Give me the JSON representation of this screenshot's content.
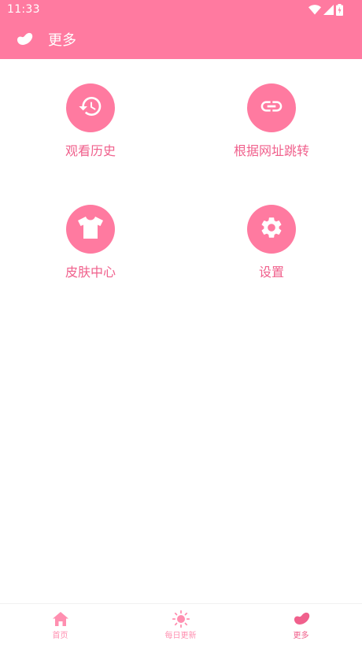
{
  "colors": {
    "primary": "#ff7aa0",
    "label": "#f0608c",
    "nav_inactive": "#ff8fb0",
    "background": "#ffffff"
  },
  "status_bar": {
    "time": "11:33",
    "icons": [
      "wifi-icon",
      "cellular-signal-icon",
      "battery-charging-icon"
    ]
  },
  "app_bar": {
    "logo_icon": "bean-logo-icon",
    "title": "更多"
  },
  "menu": [
    {
      "label": "观看历史",
      "icon": "history-icon"
    },
    {
      "label": "根据网址跳转",
      "icon": "link-icon"
    },
    {
      "label": "皮肤中心",
      "icon": "tshirt-icon"
    },
    {
      "label": "设置",
      "icon": "gear-icon"
    }
  ],
  "bottom_nav": {
    "items": [
      {
        "label": "首页",
        "icon": "home-icon",
        "active": false
      },
      {
        "label": "每日更新",
        "icon": "sun-icon",
        "active": false
      },
      {
        "label": "更多",
        "icon": "bean-icon",
        "active": true
      }
    ]
  }
}
